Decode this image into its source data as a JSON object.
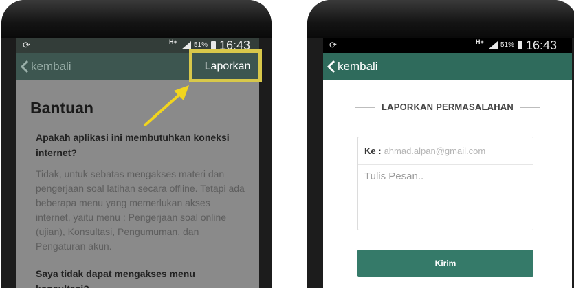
{
  "left_screen": {
    "status": {
      "network": "H+",
      "battery": "51%",
      "time": "16:43"
    },
    "appbar": {
      "back_label": "kembali",
      "report_label": "Laporkan"
    },
    "help": {
      "title": "Bantuan",
      "q1": "Apakah aplikasi ini membutuhkan koneksi internet?",
      "a1": "Tidak, untuk sebatas mengakses materi dan pengerjaan soal latihan secara offline. Tetapi ada beberapa menu yang memerlukan akses internet, yaitu menu : Pengerjaan soal online (ujian), Konsultasi, Pengumuman, dan Pengaturan akun.",
      "q2": "Saya tidak dapat mengakses menu konsultasi?"
    }
  },
  "right_screen": {
    "status": {
      "network": "H+",
      "battery": "51%",
      "time": "16:43"
    },
    "appbar": {
      "back_label": "kembali"
    },
    "form": {
      "heading": "LAPORKAN PERMASALAHAN",
      "to_label": "Ke :",
      "to_value": "ahmad.alpan@gmail.com",
      "message_placeholder": "Tulis Pesan..",
      "send_label": "Kirim"
    }
  },
  "colors": {
    "accent": "#2f6b5c",
    "highlight": "#d8c84a",
    "arrow": "#f2d51e"
  },
  "icons": [
    "sync-icon",
    "signal-icon",
    "battery-icon",
    "chevron-left-icon",
    "arrow-icon"
  ]
}
